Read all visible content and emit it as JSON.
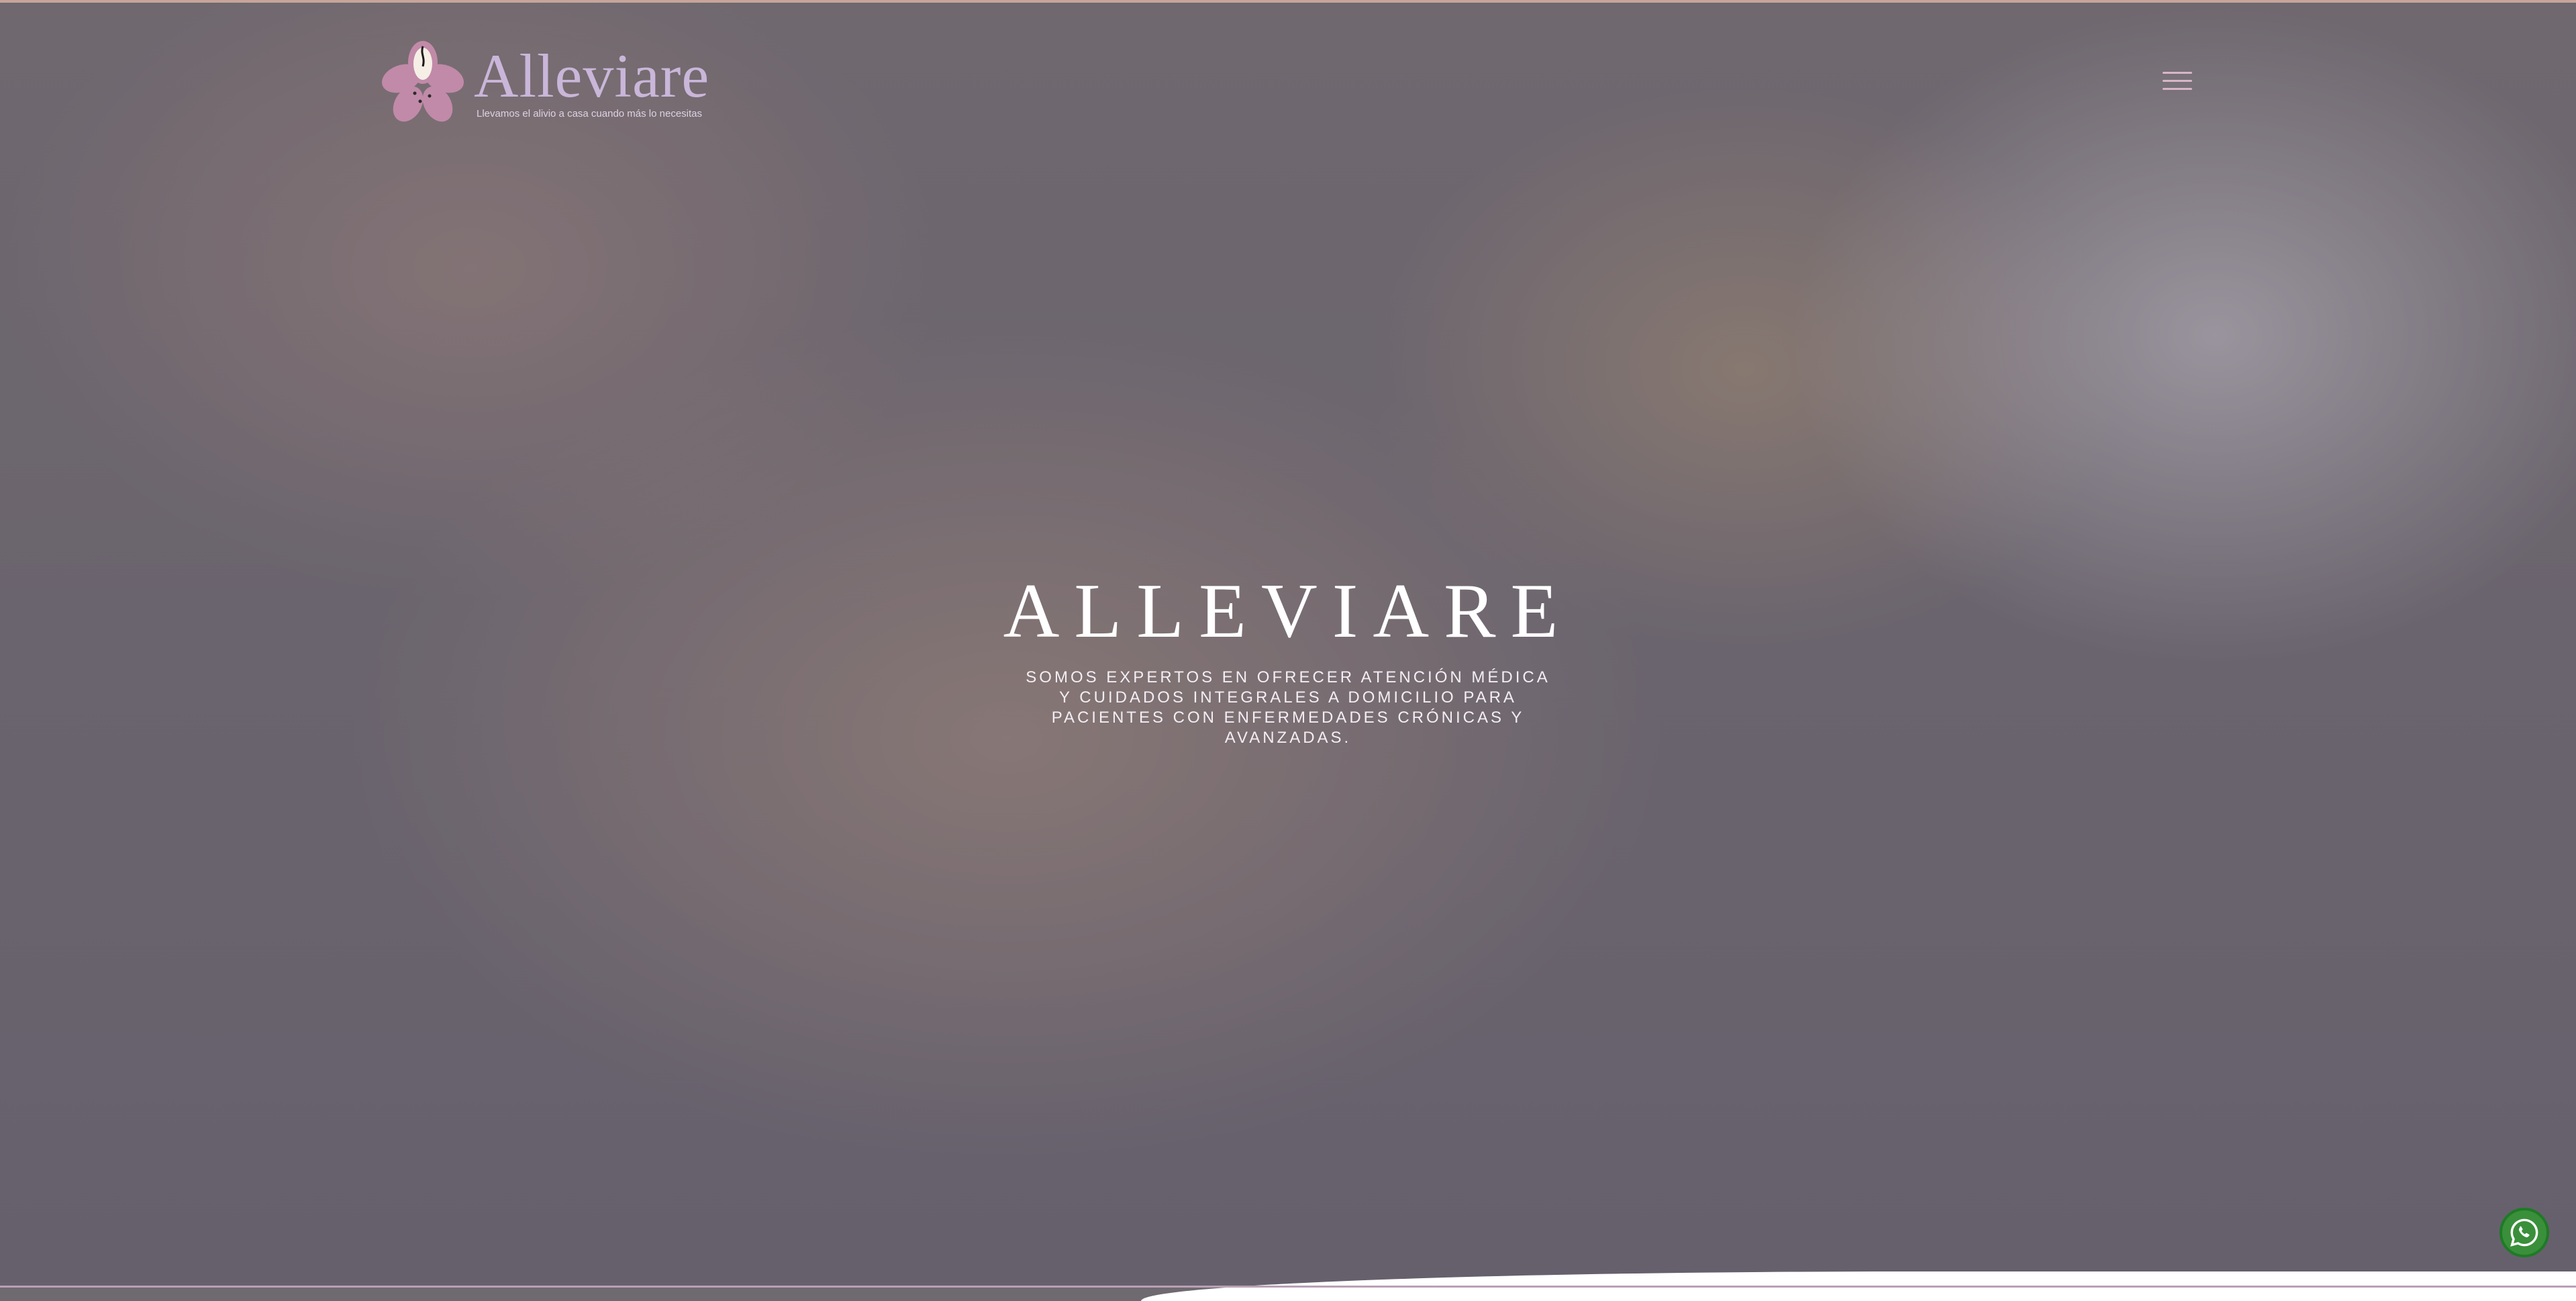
{
  "brand": {
    "name": "Alleviare",
    "tagline": "Llevamos el alivio a casa cuando más lo necesitas",
    "colors": {
      "petal": "#c18aa8",
      "text": "#c9b6d9",
      "accent": "#d9b5c8"
    }
  },
  "nav": {
    "menu_icon": "hamburger-icon"
  },
  "hero": {
    "title": "ALLEVIARE",
    "subtitle": "SOMOS EXPERTOS EN OFRECER ATENCIÓN MÉDICA Y CUIDADOS INTEGRALES A DOMICILIO PARA PACIENTES CON ENFERMEDADES CRÓNICAS Y AVANZADAS."
  },
  "floating": {
    "whatsapp_icon": "whatsapp-icon",
    "whatsapp_color": "#25d366"
  }
}
